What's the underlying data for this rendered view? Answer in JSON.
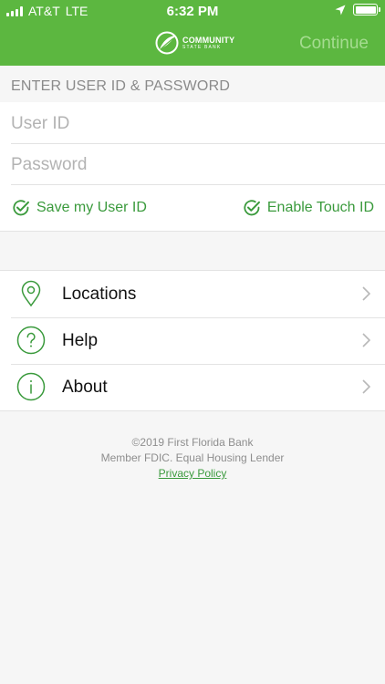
{
  "status_bar": {
    "carrier": "AT&T",
    "network": "LTE",
    "time": "6:32 PM"
  },
  "header": {
    "logo_line1": "COMMUNITY",
    "logo_line2": "STATE BANK",
    "continue_label": "Continue"
  },
  "login": {
    "section_title": "ENTER USER ID & PASSWORD",
    "user_id_placeholder": "User ID",
    "password_placeholder": "Password",
    "save_user_id_label": "Save my User ID",
    "enable_touch_id_label": "Enable Touch ID"
  },
  "menu": {
    "items": [
      {
        "label": "Locations",
        "icon": "location-pin-icon"
      },
      {
        "label": "Help",
        "icon": "question-circle-icon"
      },
      {
        "label": "About",
        "icon": "info-circle-icon"
      }
    ]
  },
  "footer": {
    "copyright": "©2019 First Florida Bank",
    "member_line": "Member FDIC. Equal Housing Lender",
    "privacy_link": "Privacy Policy"
  },
  "colors": {
    "brand_green": "#5cb740",
    "accent_green": "#3a9a3c",
    "disabled_continue": "#a5dc90"
  }
}
